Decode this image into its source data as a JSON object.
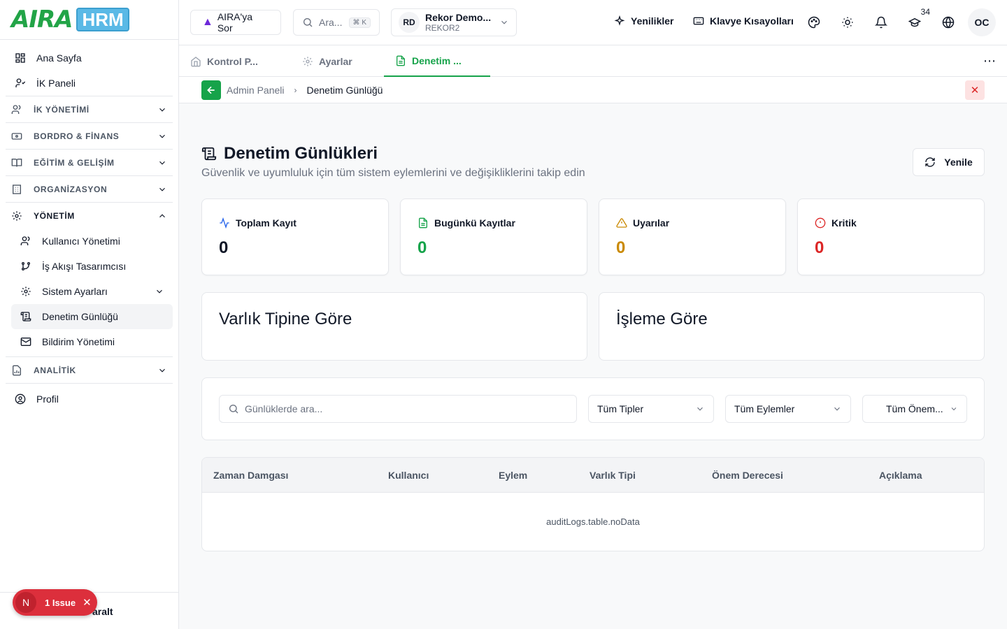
{
  "brand": {
    "logo_text": "AIRA",
    "logo_badge": "HRM"
  },
  "sidebar": {
    "top_items": [
      {
        "label": "Ana Sayfa",
        "icon": "grid-icon"
      },
      {
        "label": "İK Paneli",
        "icon": "user-check-icon"
      }
    ],
    "sections": [
      {
        "label": "İK YÖNETİMİ",
        "icon": "users-icon",
        "expanded": false
      },
      {
        "label": "BORDRO & FİNANS",
        "icon": "banknote-icon",
        "expanded": false
      },
      {
        "label": "EĞİTİM & GELİŞİM",
        "icon": "book-icon",
        "expanded": false
      },
      {
        "label": "ORGANİZASYON",
        "icon": "building-icon",
        "expanded": false
      },
      {
        "label": "YÖNETİM",
        "icon": "gear-icon",
        "expanded": true
      },
      {
        "label": "ANALİTİK",
        "icon": "chart-file-icon",
        "expanded": false
      }
    ],
    "yonetim_items": [
      {
        "label": "Kullanıcı Yönetimi",
        "icon": "users-icon"
      },
      {
        "label": "İş Akışı Tasarımcısı",
        "icon": "workflow-icon"
      },
      {
        "label": "Sistem Ayarları",
        "icon": "gear-icon"
      },
      {
        "label": "Denetim Günlüğü",
        "icon": "scroll-icon",
        "active": true
      },
      {
        "label": "Bildirim Yönetimi",
        "icon": "mail-icon"
      }
    ],
    "profile_label": "Profil",
    "collapse_label": "aralt",
    "issue": {
      "letter": "N",
      "text": "1 Issue"
    }
  },
  "topbar": {
    "ask_label": "AIRA'ya Sor",
    "search_placeholder": "Ara...",
    "search_kbd": "⌘ K",
    "company": {
      "initials": "RD",
      "name": "Rekor Demo...",
      "code": "REKOR2"
    },
    "news_label": "Yenilikler",
    "shortcuts_label": "Klavye Kısayolları",
    "training_badge": "34",
    "user_initials": "OC"
  },
  "tabs": [
    {
      "label": "Kontrol P...",
      "icon": "home-icon",
      "active": false
    },
    {
      "label": "Ayarlar",
      "icon": "gear-icon",
      "active": false
    },
    {
      "label": "Denetim ...",
      "icon": "file-icon",
      "active": true
    }
  ],
  "breadcrumb": {
    "parent": "Admin Paneli",
    "current": "Denetim Günlüğü"
  },
  "page": {
    "title": "Denetim Günlükleri",
    "subtitle": "Güvenlik ve uyumluluk için tüm sistem eylemlerini ve değişikliklerini takip edin",
    "refresh_label": "Yenile"
  },
  "stats": [
    {
      "label": "Toplam Kayıt",
      "value": "0",
      "color": "#111827",
      "icon_color": "#2563eb"
    },
    {
      "label": "Bugünkü Kayıtlar",
      "value": "0",
      "color": "#16a34a",
      "icon_color": "#16a34a"
    },
    {
      "label": "Uyarılar",
      "value": "0",
      "color": "#ca8a04",
      "icon_color": "#ca8a04"
    },
    {
      "label": "Kritik",
      "value": "0",
      "color": "#dc2626",
      "icon_color": "#dc2626"
    }
  ],
  "breakdowns": {
    "by_entity": "Varlık Tipine Göre",
    "by_action": "İşleme Göre"
  },
  "filters": {
    "search_placeholder": "Günlüklerde ara...",
    "type_select": "Tüm Tipler",
    "action_select": "Tüm Eylemler",
    "severity_select": "Tüm Önem..."
  },
  "table": {
    "columns": [
      "Zaman Damgası",
      "Kullanıcı",
      "Eylem",
      "Varlık Tipi",
      "Önem Derecesi",
      "Açıklama"
    ],
    "empty_text": "auditLogs.table.noData"
  }
}
